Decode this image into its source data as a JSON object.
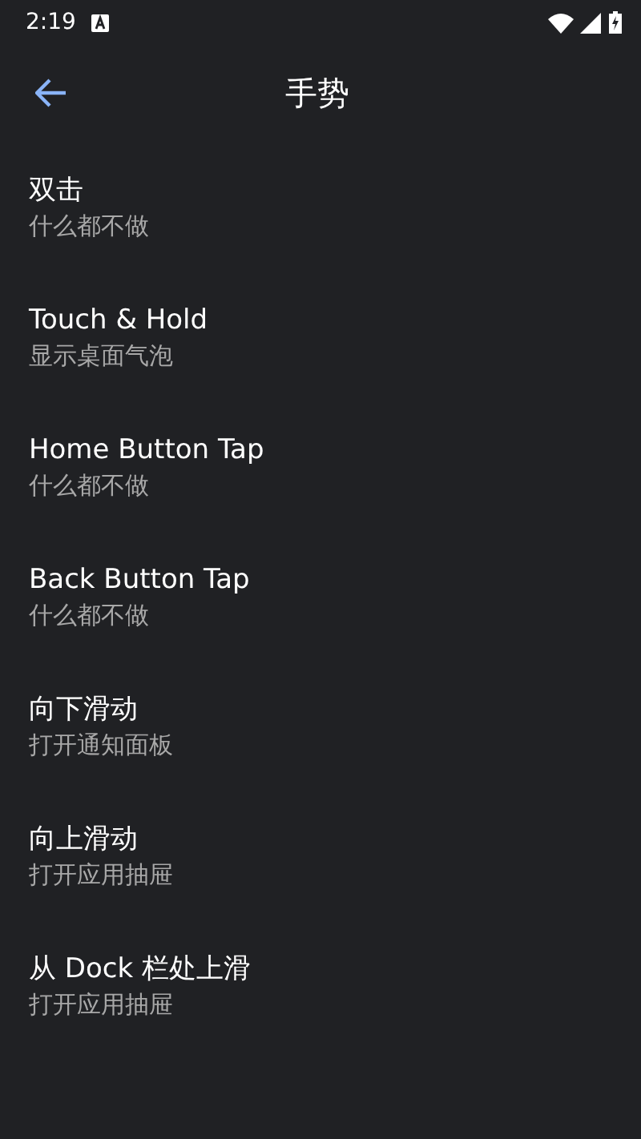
{
  "status_bar": {
    "time": "2:19"
  },
  "toolbar": {
    "title": "手势"
  },
  "settings": [
    {
      "title": "双击",
      "summary": "什么都不做"
    },
    {
      "title": "Touch & Hold",
      "summary": "显示桌面气泡"
    },
    {
      "title": "Home Button Tap",
      "summary": "什么都不做"
    },
    {
      "title": "Back Button Tap",
      "summary": "什么都不做"
    },
    {
      "title": "向下滑动",
      "summary": "打开通知面板"
    },
    {
      "title": "向上滑动",
      "summary": "打开应用抽屉"
    },
    {
      "title": "从 Dock 栏处上滑",
      "summary": "打开应用抽屉"
    }
  ]
}
